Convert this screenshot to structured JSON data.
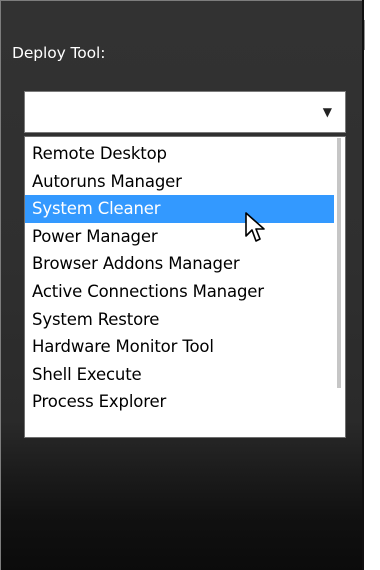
{
  "deploy": {
    "label": "Deploy Tool:",
    "selected_value": "",
    "options": [
      "Remote Desktop",
      "Autoruns Manager",
      "System Cleaner",
      "Power Manager",
      "Browser Addons Manager",
      "Active Connections Manager",
      "System Restore",
      "Hardware Monitor Tool",
      "Shell Execute",
      "Process Explorer"
    ],
    "highlighted_option": "System Cleaner"
  },
  "icons": {
    "dropdown_arrow": "chevron-down-icon",
    "cursor": "mouse-pointer-icon"
  },
  "colors": {
    "panel_background": "#2f2f2f",
    "highlight": "#3399ff",
    "list_background": "#ffffff"
  }
}
